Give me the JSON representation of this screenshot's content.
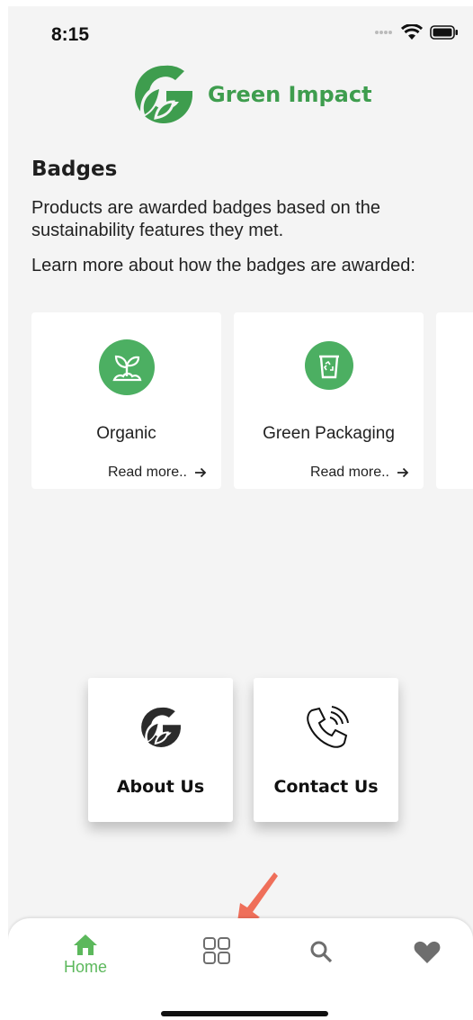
{
  "status_bar": {
    "time": "8:15"
  },
  "brand": {
    "name": "Green Impact",
    "logo_icon": "leaf-g-logo-icon",
    "color": "#3e9d4e"
  },
  "badges_section": {
    "title": "Badges",
    "description": "Products are awarded badges based on the sustainability features they met.",
    "learn_more": "Learn more about how the badges are awarded:",
    "items": [
      {
        "label": "Organic",
        "icon": "sprout-icon",
        "read_more": "Read more.."
      },
      {
        "label": "Green Packaging",
        "icon": "recycle-bin-icon",
        "read_more": "Read more.."
      }
    ]
  },
  "quick_links": [
    {
      "label": "About Us",
      "icon": "leaf-g-logo-icon"
    },
    {
      "label": "Contact Us",
      "icon": "phone-icon"
    }
  ],
  "bottom_nav": {
    "items": [
      {
        "label": "Home",
        "icon": "home-icon",
        "active": true
      },
      {
        "label": "",
        "icon": "grid-icon",
        "active": false
      },
      {
        "label": "",
        "icon": "search-icon",
        "active": false
      },
      {
        "label": "",
        "icon": "heart-icon",
        "active": false
      }
    ],
    "active_color": "#5cb85c",
    "inactive_color": "#6e6e6e"
  },
  "colors": {
    "badge_green": "#4caf62",
    "annotation": "#ef6f5a",
    "background": "#f4f4f4"
  }
}
